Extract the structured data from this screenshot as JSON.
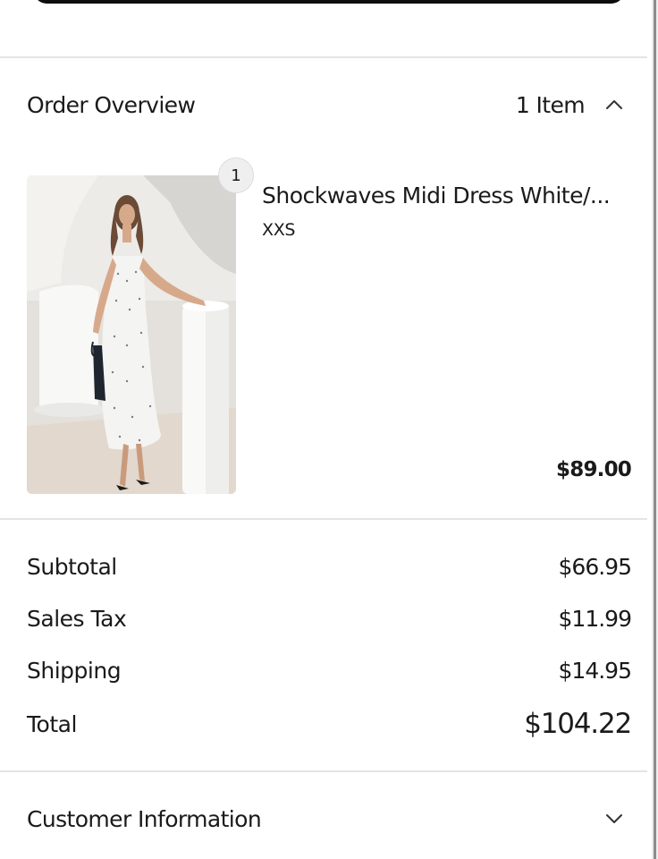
{
  "order_overview": {
    "title": "Order Overview",
    "item_count": "1 Item",
    "expanded_icon": "chevron-up-icon"
  },
  "product": {
    "quantity": "1",
    "name": "Shockwaves Midi Dress White/...",
    "variant": "XXS",
    "price": "$89.00",
    "image": "photo of a woman in a white polka-dot strappy midi dress"
  },
  "summary": {
    "subtotal_label": "Subtotal",
    "subtotal_value": "$66.95",
    "tax_label": "Sales Tax",
    "tax_value": "$11.99",
    "shipping_label": "Shipping",
    "shipping_value": "$14.95",
    "total_label": "Total",
    "total_value": "$104.22"
  },
  "customer_information": {
    "title": "Customer Information",
    "collapsed_icon": "chevron-down-icon"
  }
}
